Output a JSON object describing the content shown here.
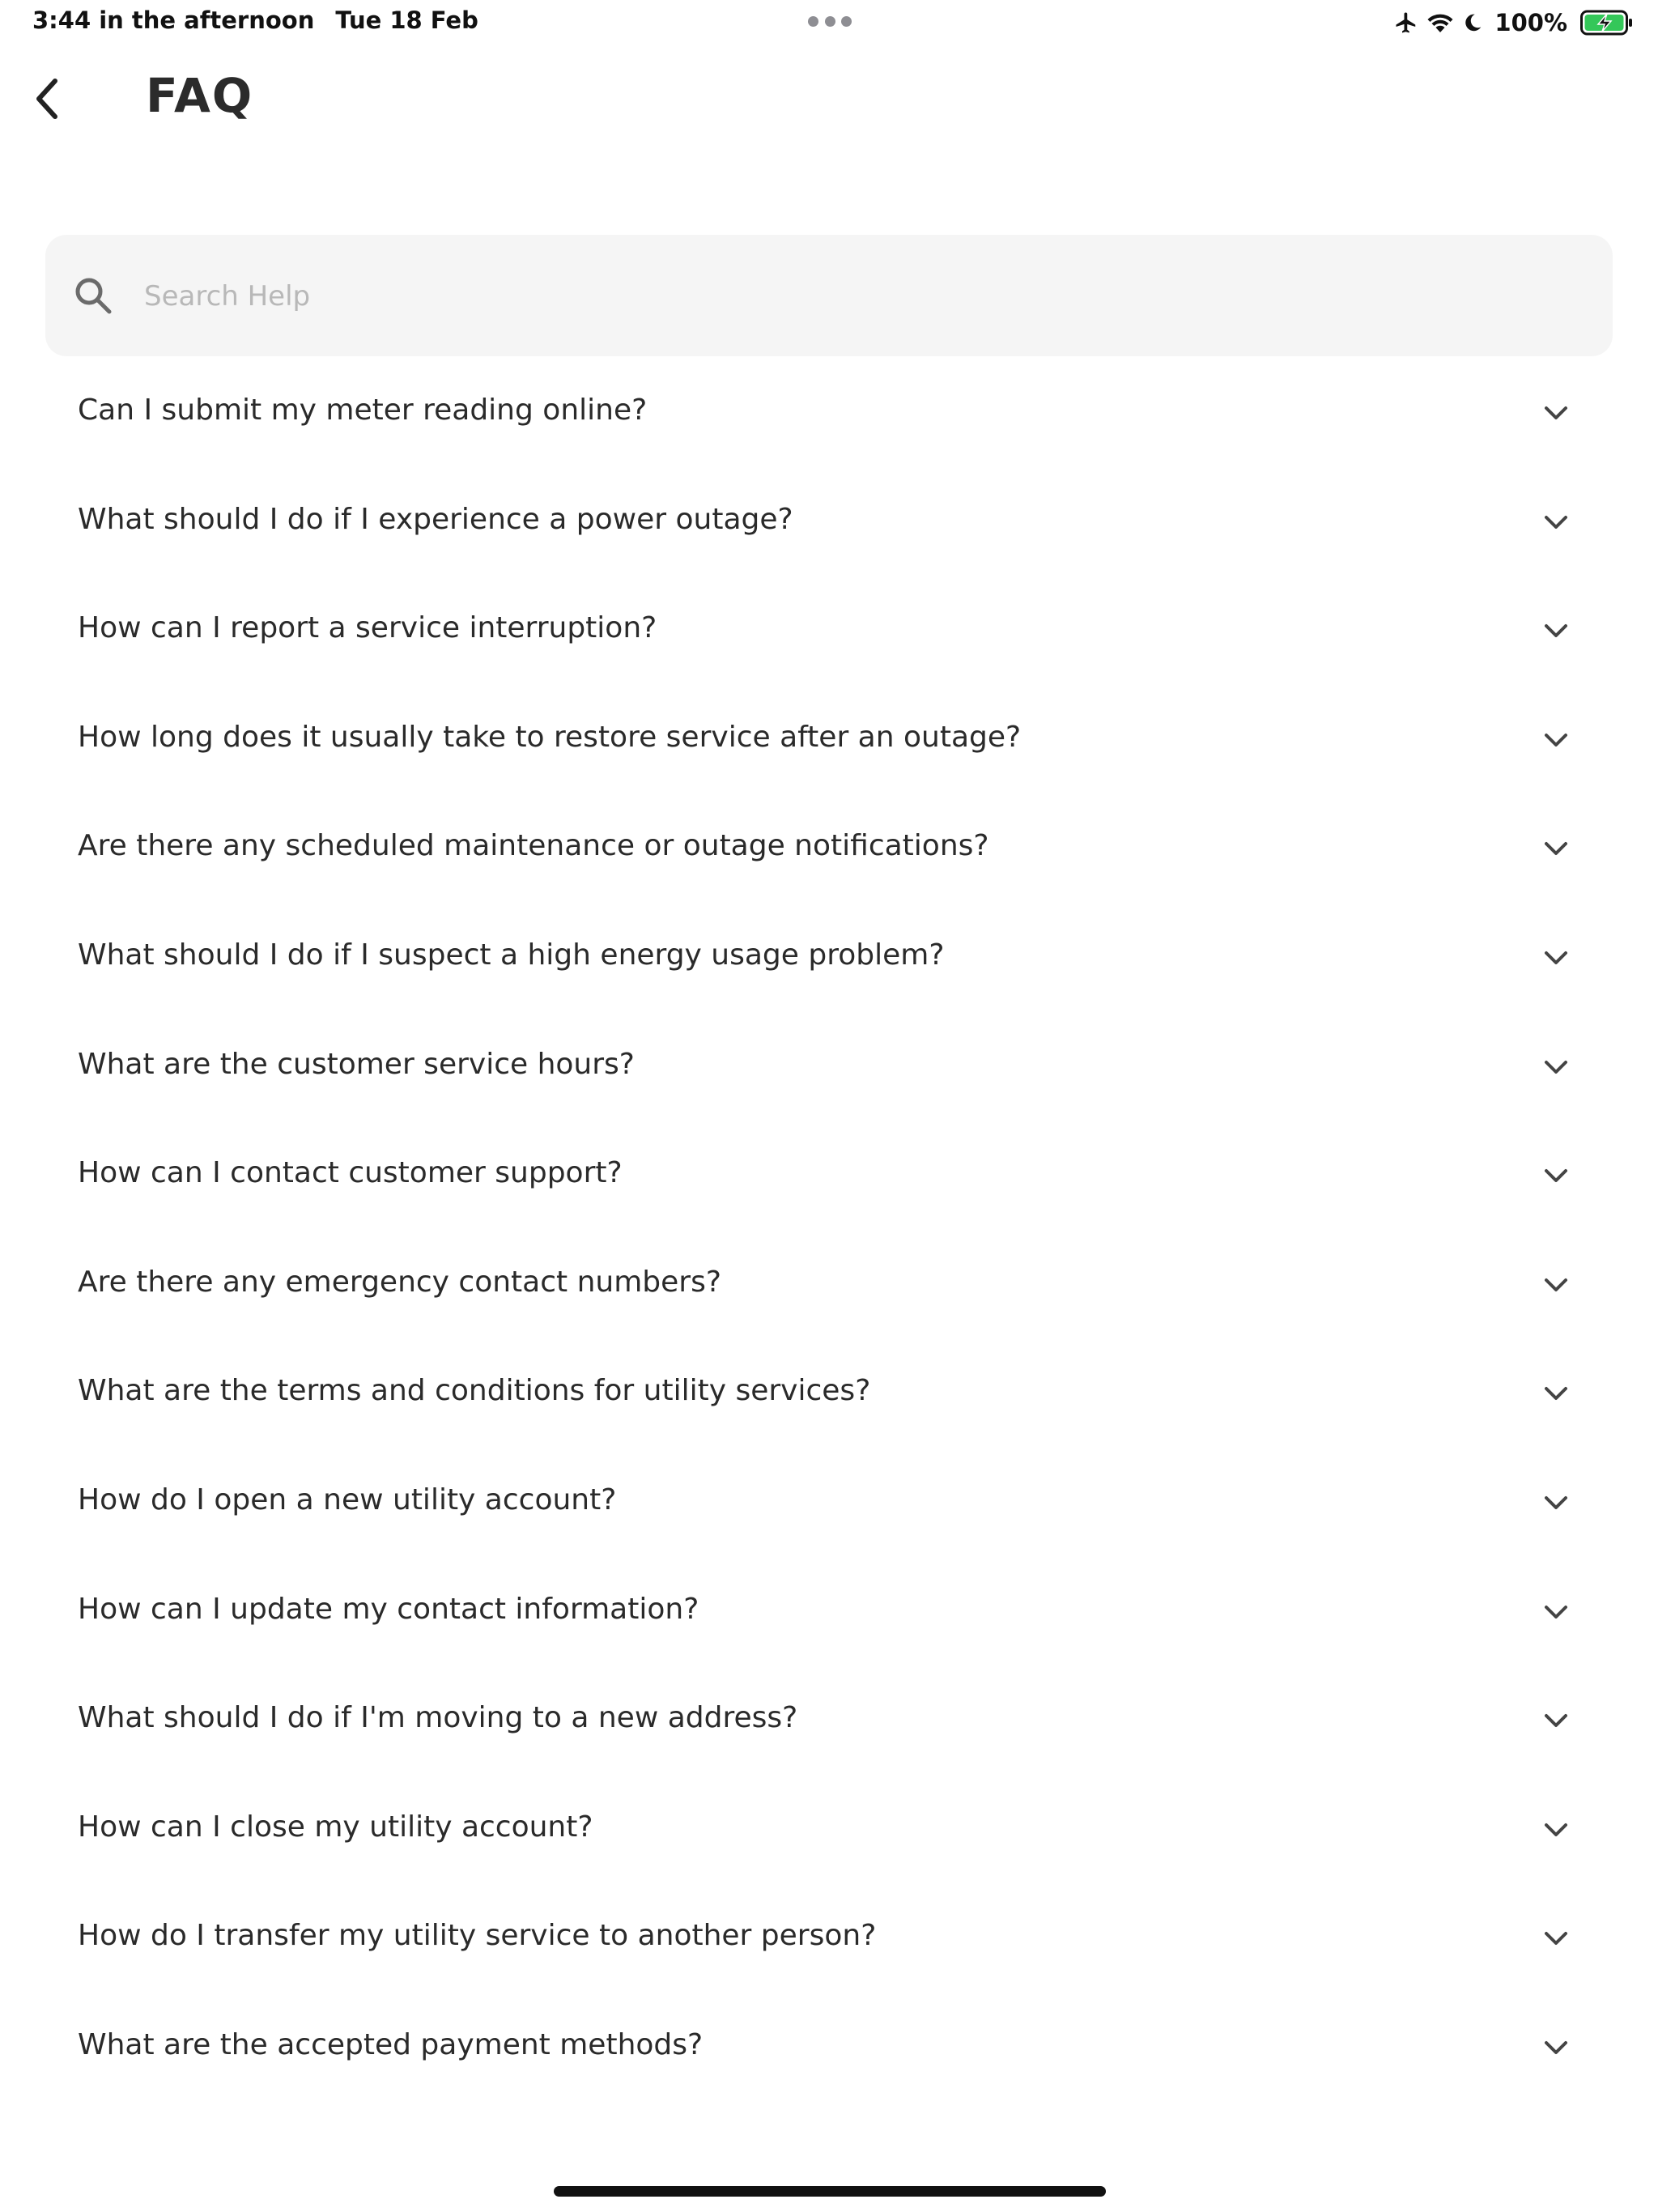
{
  "status_bar": {
    "time": "3:44 in the afternoon",
    "date": "Tue 18 Feb",
    "battery": "100%",
    "icons": [
      "airplane-icon",
      "wifi-icon",
      "moon-icon",
      "battery-charging-icon"
    ]
  },
  "header": {
    "title": "FAQ",
    "back_icon": "chevron-left-icon"
  },
  "search": {
    "placeholder": "Search Help",
    "value": ""
  },
  "faq": {
    "items": [
      {
        "question": "Can I submit my meter reading online?"
      },
      {
        "question": "What should I do if I experience a power outage?"
      },
      {
        "question": "How can I report a service interruption?"
      },
      {
        "question": "How long does it usually take to restore service after an outage?"
      },
      {
        "question": "Are there any scheduled maintenance or outage notifications?"
      },
      {
        "question": "What should I do if I suspect a high energy usage problem?"
      },
      {
        "question": "What are the customer service hours?"
      },
      {
        "question": "How can I contact customer support?"
      },
      {
        "question": "Are there any emergency contact numbers?"
      },
      {
        "question": "What are the terms and conditions for utility services?"
      },
      {
        "question": "How do I open a new utility account?"
      },
      {
        "question": "How can I update my contact information?"
      },
      {
        "question": "What should I do if I'm moving to a new address?"
      },
      {
        "question": "How can I close my utility account?"
      },
      {
        "question": "How do I transfer my utility service to another person?"
      },
      {
        "question": "What are the accepted payment methods?"
      }
    ]
  },
  "colors": {
    "background": "#ffffff",
    "search_bg": "#f5f5f5",
    "text": "#2a2a2a",
    "placeholder": "#b8b8b8",
    "battery_green": "#34c759"
  }
}
